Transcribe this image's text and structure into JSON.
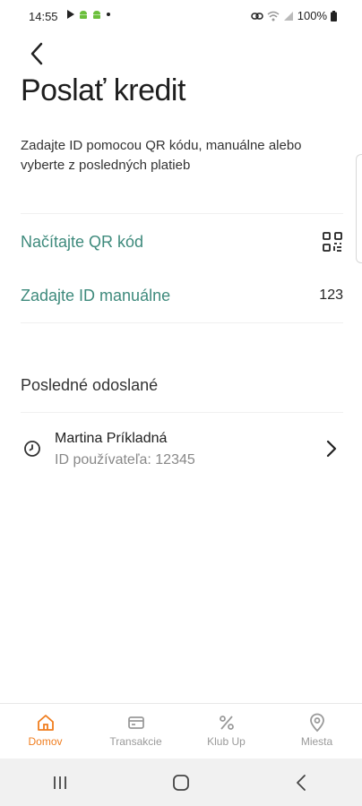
{
  "status_bar": {
    "time": "14:55",
    "battery": "100%"
  },
  "header": {
    "title": "Poslať kredit",
    "subtitle": "Zadajte ID pomocou QR kódu, manuálne alebo vyberte z posledných platieb"
  },
  "options": [
    {
      "label": "Načítajte QR kód",
      "icon": "qr-code-icon"
    },
    {
      "label": "Zadajte ID manuálne",
      "trail": "123"
    }
  ],
  "recent": {
    "title": "Posledné odoslané",
    "items": [
      {
        "name": "Martina Príkladná",
        "user_id": "ID používateľa: 12345",
        "icon": "clock-icon"
      }
    ]
  },
  "bottom_nav": {
    "items": [
      {
        "label": "Domov",
        "icon": "home-icon",
        "active": true
      },
      {
        "label": "Transakcie",
        "icon": "card-icon",
        "active": false
      },
      {
        "label": "Klub Up",
        "icon": "percent-icon",
        "active": false
      },
      {
        "label": "Miesta",
        "icon": "location-pin-icon",
        "active": false
      }
    ]
  },
  "colors": {
    "accent_teal": "#3e8a7c",
    "active_orange": "#f07d1e",
    "inactive_gray": "#9a9a9a"
  }
}
